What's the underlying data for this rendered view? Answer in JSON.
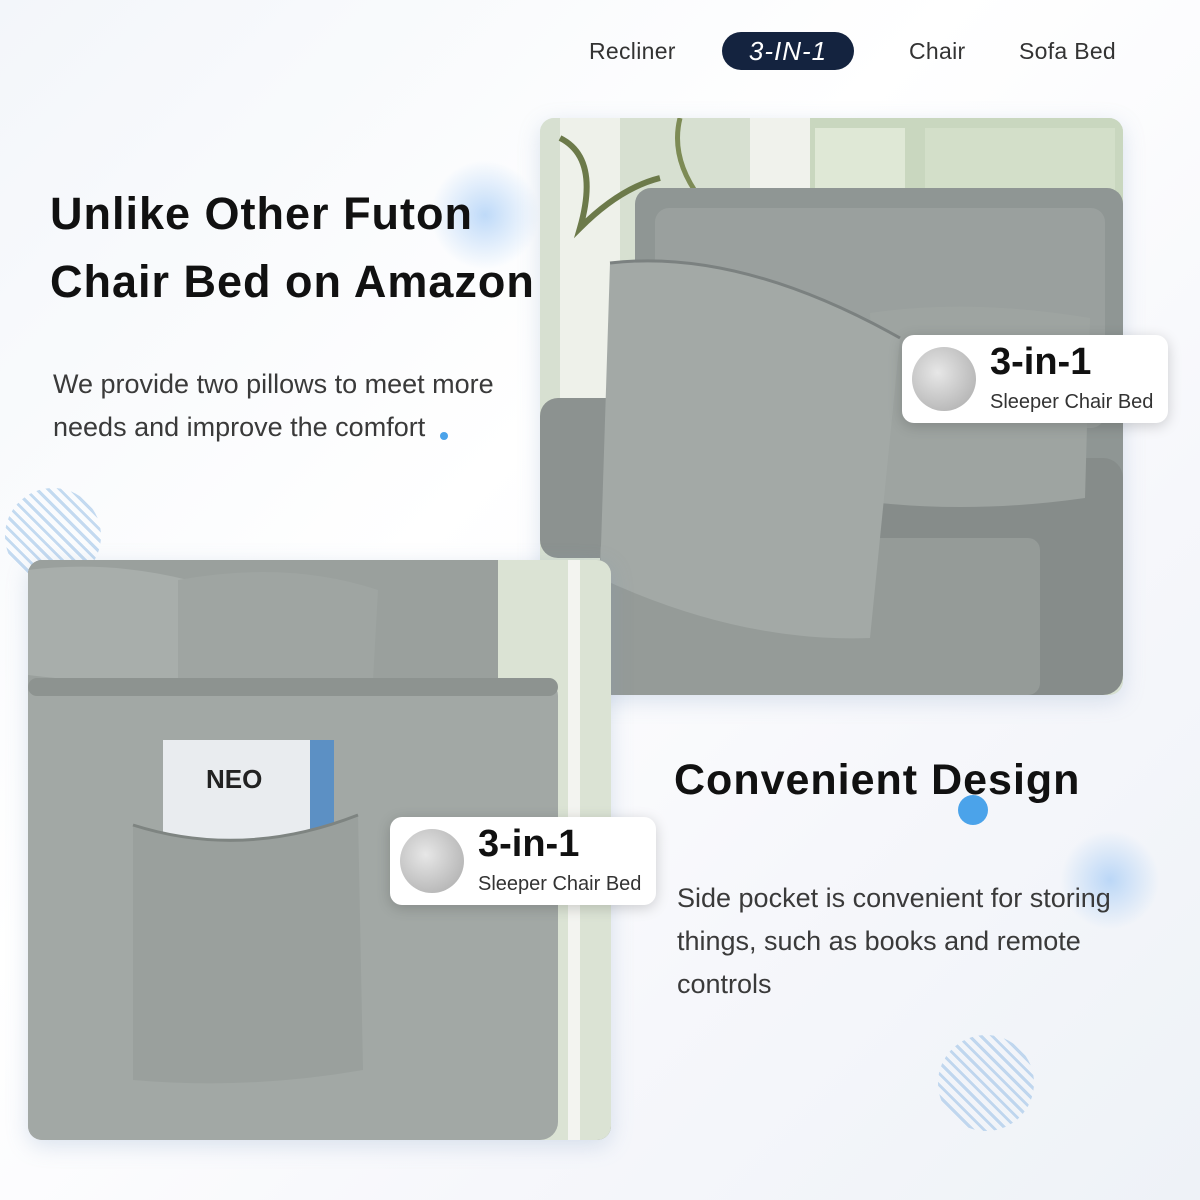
{
  "nav": {
    "items": [
      "Recliner",
      "3-IN-1",
      "Chair",
      "Sofa Bed"
    ],
    "active": "3-IN-1"
  },
  "section1": {
    "title_line1": "Unlike Other Futon",
    "title_line2": "Chair Bed on Amazon",
    "desc_line1": "We provide two pillows to meet more",
    "desc_line2": "needs and improve the comfort"
  },
  "badge1": {
    "title": "3-in-1",
    "subtitle": "Sleeper Chair Bed"
  },
  "badge2": {
    "title": "3-in-1",
    "subtitle": "Sleeper Chair Bed"
  },
  "section2": {
    "title": "Convenient Design",
    "desc_line1": "Side pocket is convenient for storing",
    "desc_line2": "things, such as books and remote",
    "desc_line3": "controls"
  },
  "book": {
    "cover_text": "NEO"
  },
  "colors": {
    "nav_active_bg": "#14233f",
    "accent_dot": "#4ba3ea",
    "fabric": "#9ea3a0"
  }
}
